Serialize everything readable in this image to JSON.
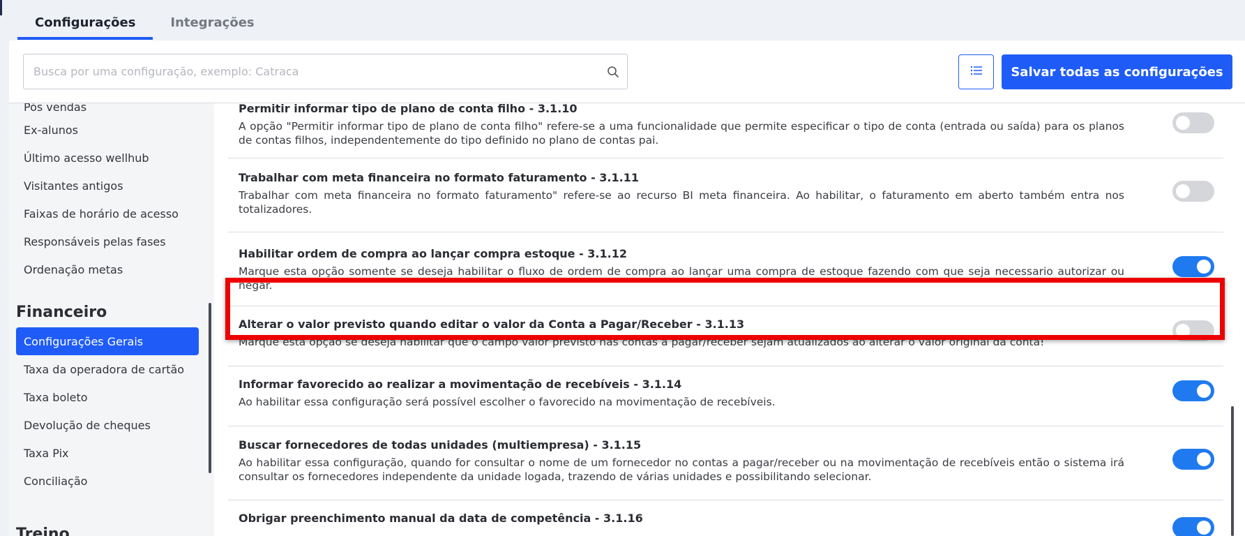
{
  "tabs": [
    {
      "label": "Configurações",
      "active": true
    },
    {
      "label": "Integrações",
      "active": false
    }
  ],
  "search": {
    "placeholder": "Busca por uma configuração, exemplo: Catraca",
    "value": ""
  },
  "toolbar": {
    "list_icon": "list-icon",
    "save_label": "Salvar todas as configurações"
  },
  "sidebar": {
    "items_top": [
      {
        "label": "Pós vendas"
      },
      {
        "label": "Ex-alunos"
      },
      {
        "label": "Último acesso wellhub"
      },
      {
        "label": "Visitantes antigos"
      },
      {
        "label": "Faixas de horário de acesso"
      },
      {
        "label": "Responsáveis pelas fases"
      },
      {
        "label": "Ordenação metas"
      }
    ],
    "section_financeiro": "Financeiro",
    "items_fin": [
      {
        "label": "Configurações Gerais",
        "active": true
      },
      {
        "label": "Taxa da operadora de cartão"
      },
      {
        "label": "Taxa boleto"
      },
      {
        "label": "Devolução de cheques"
      },
      {
        "label": "Taxa Pix"
      },
      {
        "label": "Conciliação"
      }
    ],
    "section_next": "Treino"
  },
  "settings": [
    {
      "title": "Permitir informar tipo de plano de conta filho - 3.1.10",
      "description": "A opção \"Permitir informar tipo de plano de conta filho\" refere-se a uma funcionalidade que permite especificar o tipo de conta (entrada ou saída) para os planos de contas filhos, independentemente do tipo definido no plano de contas pai.",
      "enabled": false
    },
    {
      "title": "Trabalhar com meta financeira no formato faturamento - 3.1.11",
      "description": "Trabalhar com meta financeira no formato faturamento\" refere-se ao recurso BI meta financeira. Ao habilitar, o faturamento em aberto também entra nos totalizadores.",
      "enabled": false
    },
    {
      "title": "Habilitar ordem de compra ao lançar compra estoque - 3.1.12",
      "description": "Marque esta opção somente se deseja habilitar o fluxo de ordem de compra ao lançar uma compra de estoque fazendo com que seja necessario autorizar ou negar.",
      "enabled": true
    },
    {
      "title": "Alterar o valor previsto quando editar o valor da Conta a Pagar/Receber - 3.1.13",
      "description": "Marque esta opção se deseja habilitar que o campo valor previsto nas contas a pagar/receber sejam atualizados ao alterar o valor original da conta!",
      "enabled": false
    },
    {
      "title": "Informar favorecido ao realizar a movimentação de recebíveis - 3.1.14",
      "description": "Ao habilitar essa configuração será possível escolher o favorecido na movimentação de recebíveis.",
      "enabled": true
    },
    {
      "title": "Buscar fornecedores de todas unidades (multiempresa) - 3.1.15",
      "description": "Ao habilitar essa configuração, quando for consultar o nome de um fornecedor no contas a pagar/receber ou na movimentação de recebíveis então o sistema irá consultar os fornecedores independente da unidade logada, trazendo de várias unidades e possibilitando selecionar.",
      "enabled": true
    },
    {
      "title": "Obrigar preenchimento manual da data de competência - 3.1.16",
      "description": "",
      "enabled": true
    }
  ],
  "colors": {
    "accent": "#1f5cf7",
    "toggle_on": "#1f7af0",
    "highlight": "#ee0000"
  }
}
